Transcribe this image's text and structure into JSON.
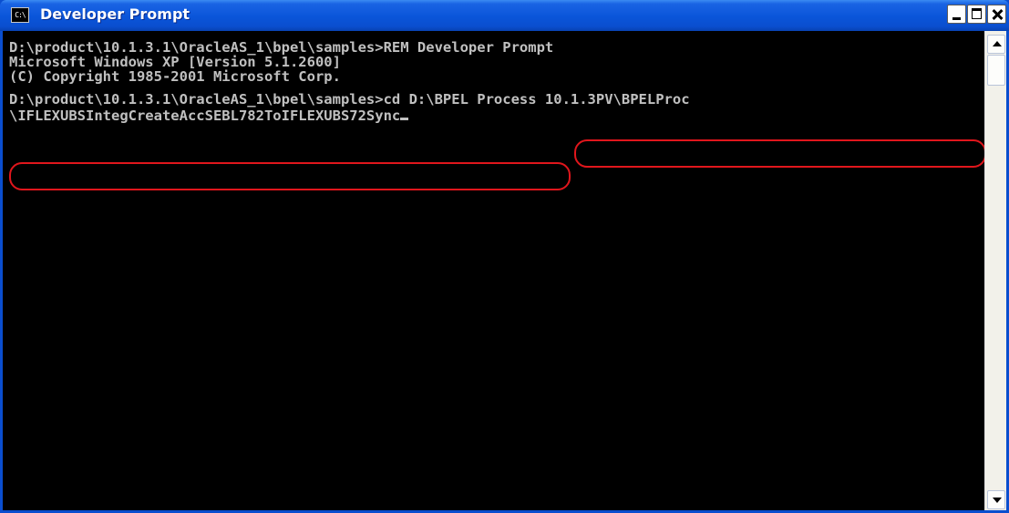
{
  "window": {
    "title": "Developer Prompt",
    "icon_text": "C:\\"
  },
  "console": {
    "lines": [
      "D:\\product\\10.1.3.1\\OracleAS_1\\bpel\\samples>REM Developer Prompt",
      "Microsoft Windows XP [Version 5.1.2600]",
      "(C) Copyright 1985-2001 Microsoft Corp.",
      "D:\\product\\10.1.3.1\\OracleAS_1\\bpel\\samples>cd D:\\BPEL Process 10.1.3PV\\BPELProc",
      "\\IFLEXUBSIntegCreateAccSEBL782ToIFLEXUBS72Sync"
    ]
  },
  "colors": {
    "titlebar": "#0a4ecf",
    "console_bg": "#000000",
    "console_fg": "#c0c0c0",
    "highlight": "#e0161c"
  }
}
